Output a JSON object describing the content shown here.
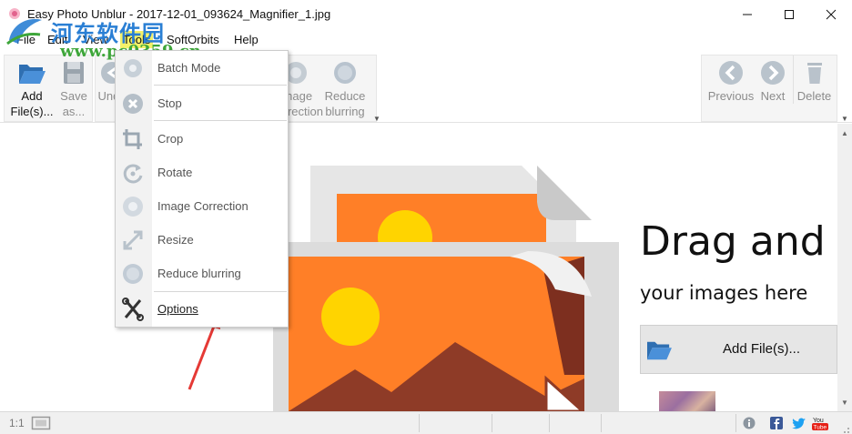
{
  "window": {
    "title": "Easy Photo Unblur - 2017-12-01_093624_Magnifier_1.jpg"
  },
  "menu": {
    "items": [
      "File",
      "Edit",
      "View",
      "Tools",
      "SoftOrbits",
      "Help"
    ],
    "active": "Tools"
  },
  "watermark": {
    "site_name": "河东软件园",
    "url": "www.pc0359.cn"
  },
  "toolbar": {
    "add_files": "Add File(s)...",
    "save_as": "Save as...",
    "undo": "Undo",
    "image_correction": "Image Correction",
    "reduce_blurring": "Reduce blurring",
    "previous": "Previous",
    "next": "Next",
    "delete": "Delete"
  },
  "tools_menu": {
    "items": [
      {
        "label": "Batch Mode",
        "icon": "gear-icon",
        "enabled": false
      },
      {
        "label": "Stop",
        "icon": "stop-icon",
        "enabled": false
      },
      {
        "label": "Crop",
        "icon": "crop-icon",
        "enabled": false
      },
      {
        "label": "Rotate",
        "icon": "rotate-icon",
        "enabled": false
      },
      {
        "label": "Image Correction",
        "icon": "image-correction-icon",
        "enabled": false
      },
      {
        "label": "Resize",
        "icon": "resize-icon",
        "enabled": false
      },
      {
        "label": "Reduce blurring",
        "icon": "reduce-blurring-icon",
        "enabled": false
      },
      {
        "label": "Options",
        "icon": "wrench-icon",
        "enabled": true
      }
    ]
  },
  "main": {
    "drag_title": "Drag and I",
    "drag_subtitle": "your images here",
    "add_files_button": "Add File(s)..."
  },
  "status": {
    "zoom": "1:1"
  },
  "colors": {
    "accent_orange": "#ff7f27",
    "sun_yellow": "#ffd400",
    "arrow_red": "#e53935",
    "highlight_yellow": "#f4f16a"
  }
}
